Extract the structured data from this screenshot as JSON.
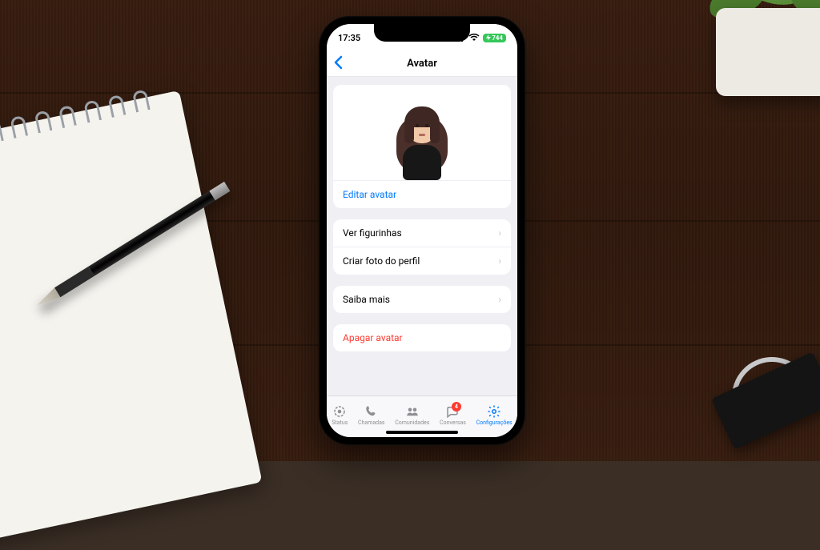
{
  "statusbar": {
    "time": "17:35",
    "battery": "744"
  },
  "nav": {
    "title": "Avatar"
  },
  "avatar_card": {
    "edit_label": "Editar avatar"
  },
  "options": {
    "stickers": "Ver figurinhas",
    "profile_photo": "Criar foto do perfil"
  },
  "learn_more": {
    "label": "Saiba mais"
  },
  "delete": {
    "label": "Apagar avatar"
  },
  "tabs": {
    "status": "Status",
    "calls": "Chamadas",
    "communities": "Comunidades",
    "chats": "Conversas",
    "settings": "Configurações",
    "chats_badge": "4"
  },
  "colors": {
    "accent": "#007aff",
    "danger": "#ff3b30",
    "battery": "#34c759"
  }
}
